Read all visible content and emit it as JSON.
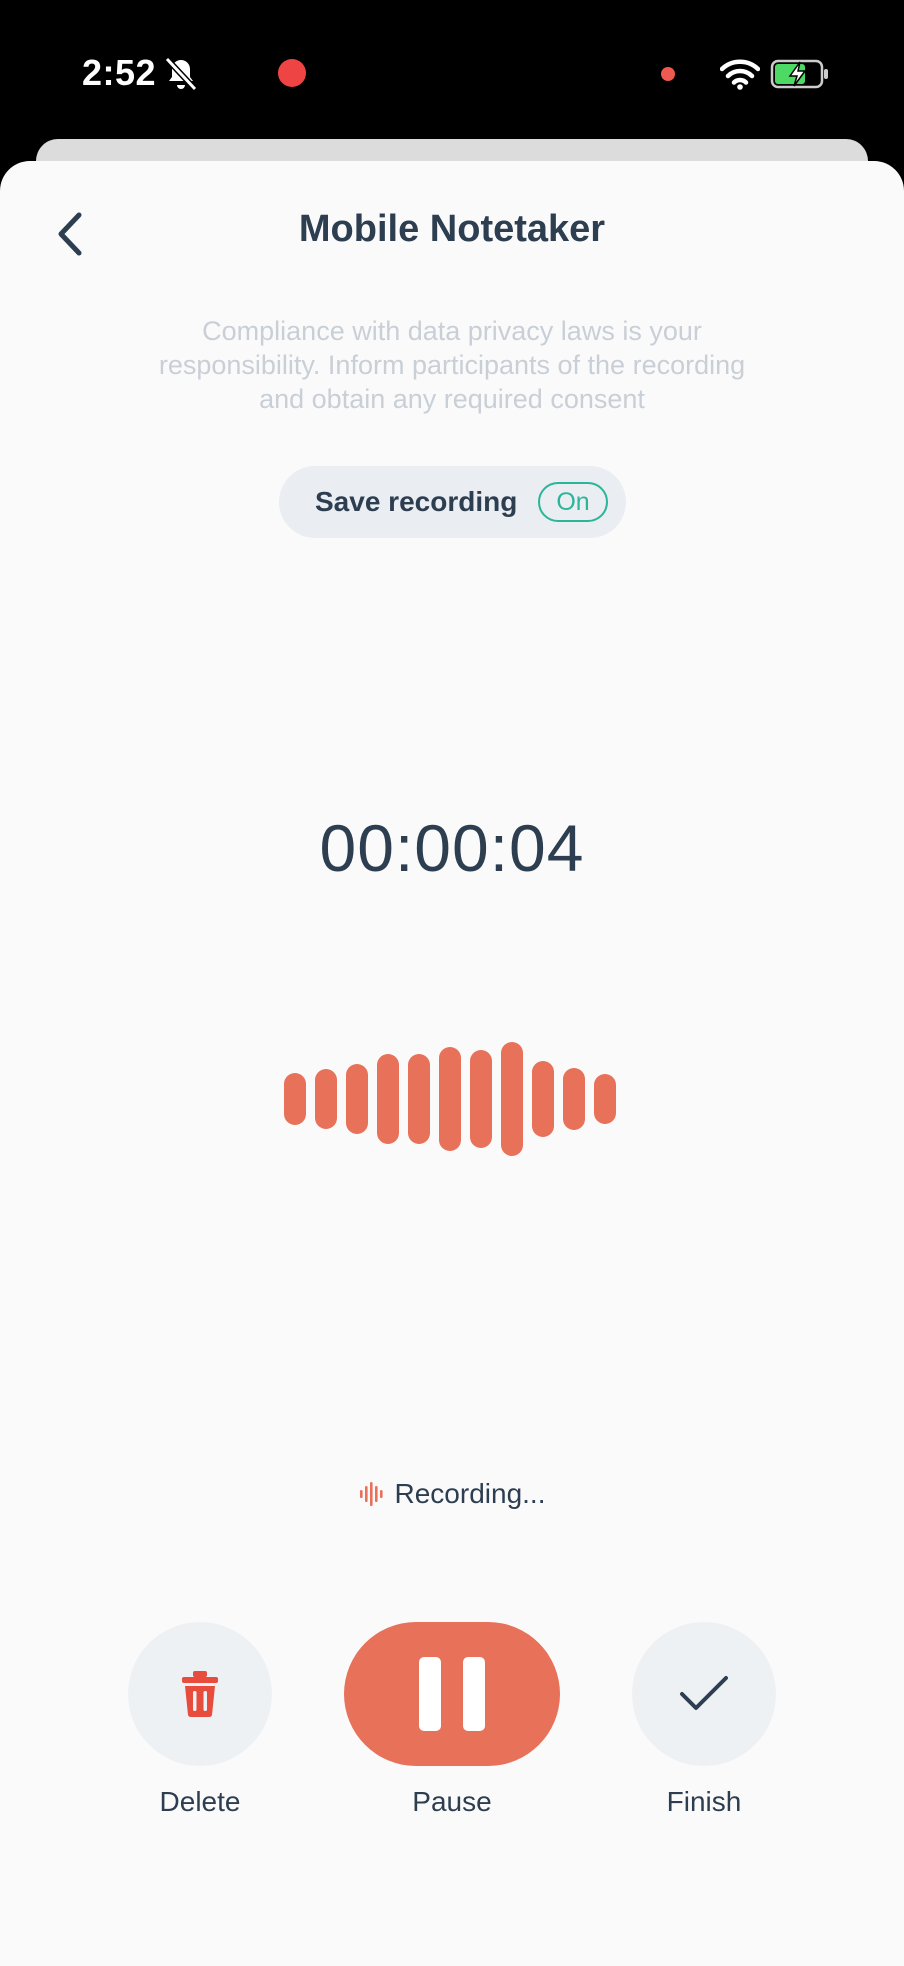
{
  "status_bar": {
    "time": "2:52",
    "icons": [
      "bell-off-icon",
      "recording-dot-icon",
      "privacy-dot-icon",
      "wifi-icon",
      "battery-charging-icon"
    ]
  },
  "header": {
    "title": "Mobile Notetaker",
    "back_icon": "chevron-left-icon"
  },
  "notice": "Compliance with data privacy laws is your responsibility. Inform participants of the recording and obtain any required consent",
  "save_recording": {
    "label": "Save recording",
    "toggle_label": "On",
    "enabled": true
  },
  "timer": "00:00:04",
  "recording_status": "Recording...",
  "controls": {
    "delete": {
      "label": "Delete",
      "icon": "trash-icon"
    },
    "pause": {
      "label": "Pause",
      "icon": "pause-icon"
    },
    "finish": {
      "label": "Finish",
      "icon": "check-icon"
    }
  },
  "colors": {
    "accent": "#e8715a",
    "toggle_on": "#2bb59a",
    "text": "#2d3e50",
    "muted_text": "#c9cfd6",
    "recording_dot": "#ef4444"
  }
}
